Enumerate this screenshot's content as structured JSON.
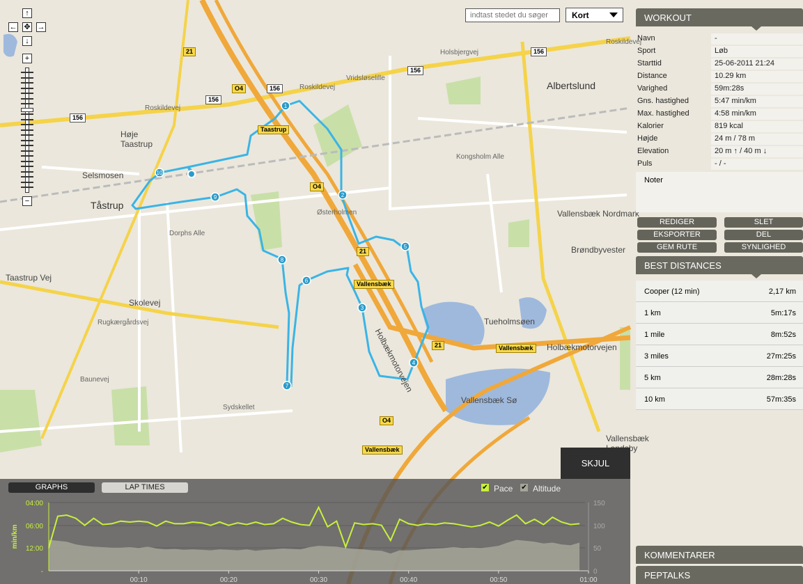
{
  "map": {
    "search_placeholder": "indtast stedet du søger",
    "map_type": "Kort",
    "zoom_in": "+",
    "zoom_out": "−",
    "pan": {
      "up": "↑",
      "down": "↓",
      "left": "←",
      "right": "→",
      "center": "✥"
    },
    "places": [
      {
        "text": "Albertslund",
        "cls": "big"
      },
      {
        "text": "Tåstrup",
        "cls": "big"
      },
      {
        "text": "Høje Taastrup",
        "cls": ""
      },
      {
        "text": "Selsmosen",
        "cls": ""
      },
      {
        "text": "Vallensbæk Nordmark",
        "cls": ""
      },
      {
        "text": "Brøndbyvester",
        "cls": ""
      },
      {
        "text": "Tueholmsøen",
        "cls": ""
      },
      {
        "text": "Vallensbæk Sø",
        "cls": ""
      },
      {
        "text": "Vallensbæk Landsby",
        "cls": ""
      },
      {
        "text": "Roskildevej",
        "cls": "small"
      },
      {
        "text": "Vridsløselille",
        "cls": "small"
      },
      {
        "text": "Kongsholm Alle",
        "cls": "small"
      },
      {
        "text": "Holbækmotorvejen",
        "cls": ""
      },
      {
        "text": "Holbækmotorvejen",
        "cls": ""
      },
      {
        "text": "Skolevej",
        "cls": ""
      },
      {
        "text": "Taastrup Vej",
        "cls": ""
      },
      {
        "text": "Rugkærgårdsvej",
        "cls": "small"
      },
      {
        "text": "Baunevej",
        "cls": "small"
      },
      {
        "text": "Sydskellet",
        "cls": "small"
      },
      {
        "text": "Dorphs Alle",
        "cls": "small"
      },
      {
        "text": "Østerholmen",
        "cls": "small"
      },
      {
        "text": "Holsbjergvej",
        "cls": "small"
      },
      {
        "text": "Roskildevej",
        "cls": "small"
      },
      {
        "text": "Roskildevej",
        "cls": "small"
      }
    ],
    "shields": [
      {
        "text": "156",
        "cls": ""
      },
      {
        "text": "156",
        "cls": ""
      },
      {
        "text": "156",
        "cls": ""
      },
      {
        "text": "156",
        "cls": ""
      },
      {
        "text": "156",
        "cls": ""
      },
      {
        "text": "21",
        "cls": "y"
      },
      {
        "text": "21",
        "cls": "y"
      },
      {
        "text": "21",
        "cls": "y"
      },
      {
        "text": "O4",
        "cls": "y"
      },
      {
        "text": "O4",
        "cls": "y"
      },
      {
        "text": "O4",
        "cls": "y"
      },
      {
        "text": "Vallensbæk",
        "cls": "y"
      },
      {
        "text": "Vallensbæk",
        "cls": "y"
      },
      {
        "text": "Vallensbæk",
        "cls": "y"
      },
      {
        "text": "Taastrup",
        "cls": "y"
      }
    ],
    "markers": [
      "1",
      "2",
      "3",
      "4",
      "5",
      "6",
      "7",
      "8",
      "9",
      "10"
    ],
    "route_color": "#3ab4e6"
  },
  "workout": {
    "title": "WORKOUT",
    "rows": [
      {
        "k": "Navn",
        "v": "-"
      },
      {
        "k": "Sport",
        "v": "Løb"
      },
      {
        "k": "Starttid",
        "v": "25-06-2011 21:24"
      },
      {
        "k": "Distance",
        "v": "10.29 km"
      },
      {
        "k": "Varighed",
        "v": "59m:28s"
      },
      {
        "k": "Gns. hastighed",
        "v": "5:47 min/km"
      },
      {
        "k": "Max. hastighed",
        "v": "4:58 min/km"
      },
      {
        "k": "Kalorier",
        "v": "819 kcal"
      },
      {
        "k": "Højde",
        "v": "24 m / 78 m"
      },
      {
        "k": "Elevation",
        "v": "20 m ↑ / 40 m ↓"
      },
      {
        "k": "Puls",
        "v": "- / -"
      }
    ],
    "notes_label": "Noter",
    "buttons": [
      "REDIGER",
      "SLET",
      "EKSPORTER",
      "DEL",
      "GEM RUTE",
      "SYNLIGHED"
    ]
  },
  "best_distances": {
    "title": "BEST DISTANCES",
    "rows": [
      {
        "k": "Cooper (12 min)",
        "v": "2,17 km"
      },
      {
        "k": "1 km",
        "v": "5m:17s"
      },
      {
        "k": "1 mile",
        "v": "8m:52s"
      },
      {
        "k": "3 miles",
        "v": "27m:25s"
      },
      {
        "k": "5 km",
        "v": "28m:28s"
      },
      {
        "k": "10 km",
        "v": "57m:35s"
      }
    ]
  },
  "kommentarer": "KOMMENTARER",
  "peptalks": "PEPTALKS",
  "bottom": {
    "hide_label": "SKJUL",
    "tabs": [
      "GRAPHS",
      "LAP TIMES"
    ],
    "legend": {
      "pace": "Pace",
      "altitude": "Altitude",
      "pace_checked": true,
      "altitude_checked": true
    }
  },
  "chart_data": {
    "type": "line",
    "xlabel": "",
    "ylabel": "min/km",
    "x_ticks": [
      "00:10",
      "00:20",
      "00:30",
      "00:40",
      "00:50",
      "01:00"
    ],
    "y_left_ticks": [
      "04:00",
      "06:00",
      "12:00",
      "-"
    ],
    "y_right_ticks": [
      "150",
      "100",
      "50",
      "0"
    ],
    "y_right_range": [
      0,
      150
    ],
    "x_range_min": [
      0,
      60
    ],
    "colors": {
      "pace": "#c8f03c",
      "altitude": "#a5a498"
    },
    "series": [
      {
        "name": "Pace",
        "unit": "min/km",
        "values": [
          12,
          5.0,
          4.9,
          5.2,
          6.0,
          5.2,
          5.9,
          5.8,
          5.5,
          5.6,
          5.5,
          5.6,
          6.1,
          5.5,
          5.8,
          5.8,
          5.6,
          5.7,
          6.0,
          5.6,
          6.0,
          5.7,
          5.9,
          5.6,
          5.9,
          5.8,
          5.2,
          5.6,
          5.9,
          6.0,
          4.3,
          6.2,
          5.5,
          11.5,
          5.7,
          5.9,
          5.8,
          6.0,
          9.0,
          5.3,
          5.8,
          6.0,
          5.8,
          5.9,
          5.7,
          5.8,
          6.0,
          6.2,
          6.0,
          5.6,
          6.1,
          5.4,
          4.9,
          5.8,
          5.3,
          5.9,
          5.1,
          5.6,
          5.9,
          5.8
        ]
      },
      {
        "name": "Altitude",
        "unit": "m",
        "values": [
          68,
          66,
          64,
          58,
          55,
          53,
          52,
          51,
          51,
          52,
          50,
          53,
          49,
          47,
          48,
          46,
          47,
          46,
          45,
          47,
          46,
          45,
          47,
          44,
          46,
          47,
          49,
          48,
          47,
          52,
          55,
          54,
          53,
          50,
          48,
          47,
          45,
          44,
          38,
          45,
          45,
          46,
          48,
          49,
          50,
          52,
          50,
          51,
          50,
          52,
          55,
          62,
          68,
          66,
          64,
          60,
          62,
          58,
          56,
          62
        ]
      }
    ]
  }
}
